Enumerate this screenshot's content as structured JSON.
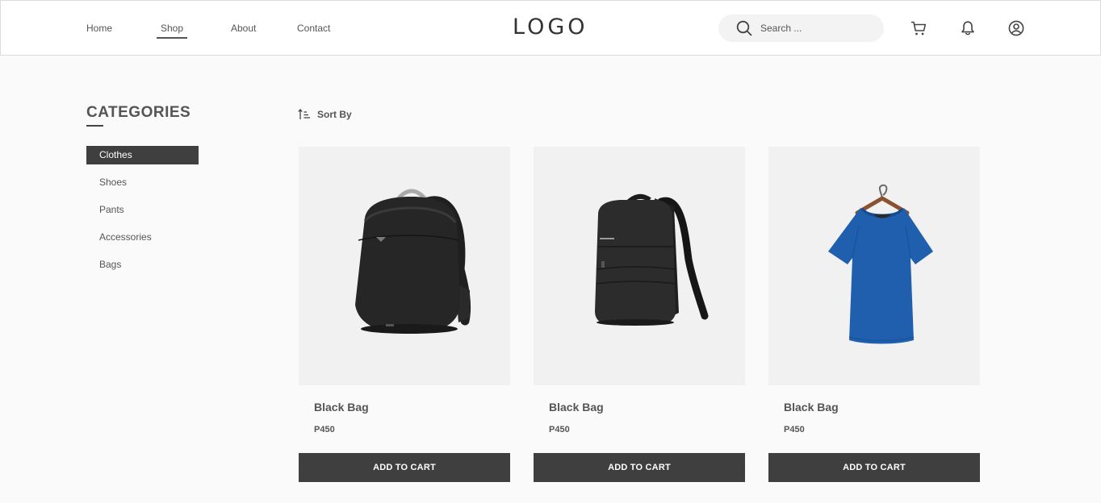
{
  "header": {
    "nav": [
      "Home",
      "Shop",
      "About",
      "Contact"
    ],
    "active_nav": "Shop",
    "logo": "LOGO",
    "search": {
      "placeholder": "Search ...",
      "value": ""
    },
    "icons": [
      "search-icon",
      "cart-icon",
      "bell-icon",
      "user-icon"
    ]
  },
  "sidebar": {
    "title": "CATEGORIES",
    "items": [
      "Clothes",
      "Shoes",
      "Pants",
      "Accessories",
      "Bags"
    ],
    "active_item": "Clothes"
  },
  "toolbar": {
    "sort_label": "Sort By",
    "sort_icon": "sort-ascending-icon"
  },
  "products": [
    {
      "name": "Black Bag",
      "price": "P450",
      "image": "black-backpack-image",
      "button": "ADD TO CART"
    },
    {
      "name": "Black Bag",
      "price": "P450",
      "image": "black-laptop-backpack-image",
      "button": "ADD TO CART"
    },
    {
      "name": "Black Bag",
      "price": "P450",
      "image": "blue-tshirt-on-hanger-image",
      "button": "ADD TO CART"
    }
  ],
  "colors": {
    "dark": "#3f3f3f",
    "page_bg": "#fafafa",
    "card_bg": "#f1f1f1",
    "shirt_blue": "#1f5fae"
  }
}
